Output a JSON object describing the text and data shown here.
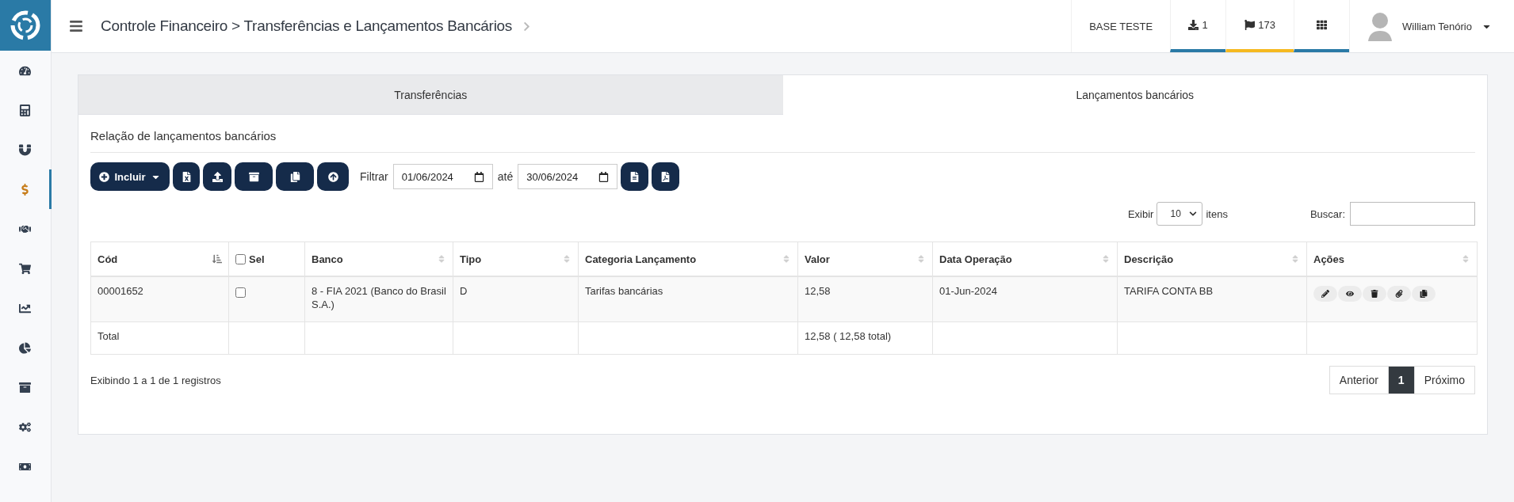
{
  "sidebar": {
    "items": [
      {
        "kind": "dashboard",
        "selected": false
      },
      {
        "kind": "calculator",
        "selected": false
      },
      {
        "kind": "magnet",
        "selected": false
      },
      {
        "kind": "dollar",
        "selected": true
      },
      {
        "kind": "handshake",
        "selected": false
      },
      {
        "kind": "cart",
        "selected": false
      },
      {
        "kind": "chart",
        "selected": false
      },
      {
        "kind": "pie",
        "selected": false
      },
      {
        "kind": "archive",
        "selected": false
      },
      {
        "kind": "cogs",
        "selected": false
      },
      {
        "kind": "money",
        "selected": false
      }
    ]
  },
  "header": {
    "breadcrumb": "Controle Financeiro > Transferências e Lançamentos Bancários",
    "base": "BASE TESTE",
    "badges": [
      {
        "kind": "download",
        "label": "1",
        "color": "#2a7aa6"
      },
      {
        "kind": "flag",
        "label": "173",
        "color": "#f5b920"
      },
      {
        "kind": "grid",
        "color": "#2a7aa6"
      }
    ],
    "user": "William Tenório"
  },
  "tabs": [
    {
      "label": "Transferências",
      "selected": false
    },
    {
      "label": "Lançamentos bancários",
      "selected": true
    }
  ],
  "section_title": "Relação de lançamentos bancários",
  "toolbar": {
    "include": "Incluir",
    "tools": [
      {
        "kind": "excel"
      },
      {
        "kind": "upload"
      },
      {
        "kind": "archive"
      },
      {
        "kind": "copy"
      },
      {
        "kind": "up"
      }
    ],
    "filter_label": "Filtrar",
    "date_from": "01/06/2024",
    "until_label": "até",
    "date_to": "30/06/2024",
    "exports": [
      {
        "kind": "file"
      },
      {
        "kind": "pdf"
      }
    ]
  },
  "length": {
    "label": "Exibir",
    "value": "10",
    "suffix": "itens"
  },
  "search": {
    "label": "Buscar:"
  },
  "table": {
    "columns": [
      {
        "label": "Cód",
        "kind": "sort",
        "sorted": true
      },
      {
        "label": "Sel",
        "kind": "checkbox",
        "checked": false
      },
      {
        "label": "Banco",
        "kind": "sort",
        "sorted": false
      },
      {
        "label": "Tipo",
        "kind": "sort",
        "sorted": false
      },
      {
        "label": "Categoria Lançamento",
        "kind": "sort",
        "sorted": false
      },
      {
        "label": "Valor",
        "kind": "sort",
        "sorted": false
      },
      {
        "label": "Data Operação",
        "kind": "sort",
        "sorted": false
      },
      {
        "label": "Descrição",
        "kind": "sort",
        "sorted": false
      },
      {
        "label": "Ações",
        "kind": "sort",
        "sorted": false
      }
    ],
    "rows": [
      {
        "cod": "00001652",
        "checked": false,
        "banco": "8 - FIA 2021 (Banco do Brasil S.A.)",
        "tipo": "D",
        "categoria": "Tarifas bancárias",
        "valor": "12,58",
        "data": "01-Jun-2024",
        "descricao": "TARIFA CONTA BB",
        "actions": [
          {
            "kind": "edit"
          },
          {
            "kind": "view"
          },
          {
            "kind": "delete"
          },
          {
            "kind": "attach"
          },
          {
            "kind": "copy"
          }
        ]
      }
    ],
    "footer": {
      "label": "Total",
      "valor": "12,58 ( 12,58 total)"
    }
  },
  "info": "Exibindo 1 a 1 de 1 registros",
  "pagination": [
    {
      "label": "Anterior",
      "selected": false
    },
    {
      "label": "1",
      "selected": true
    },
    {
      "label": "Próximo",
      "selected": false
    }
  ]
}
